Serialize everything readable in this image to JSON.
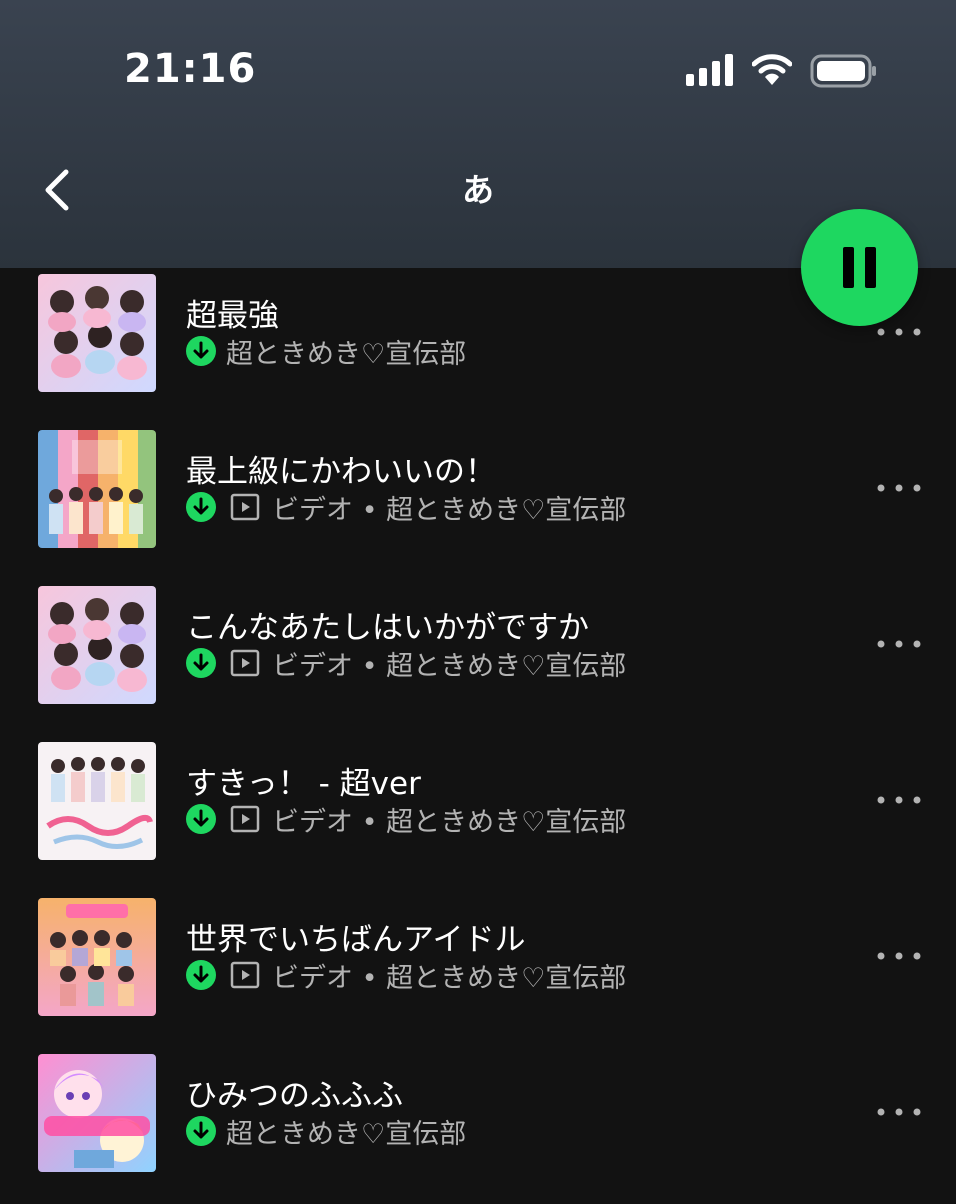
{
  "status_bar": {
    "time": "21:16",
    "signal_icon": "cellular-signal-icon",
    "wifi_icon": "wifi-icon",
    "battery_icon": "battery-icon"
  },
  "nav": {
    "title": "あ",
    "back_icon": "chevron-left-icon"
  },
  "player": {
    "state_icon": "pause-icon",
    "accent_color": "#1ed760"
  },
  "tracks": [
    {
      "title": "超最強",
      "is_video": false,
      "meta": "超ときめき♡宣伝部"
    },
    {
      "title": "最上級にかわいいの！",
      "is_video": true,
      "meta": "ビデオ • 超ときめき♡宣伝部"
    },
    {
      "title": "こんなあたしはいかがですか",
      "is_video": true,
      "meta": "ビデオ • 超ときめき♡宣伝部"
    },
    {
      "title": "すきっ！ - 超ver",
      "is_video": true,
      "meta": "ビデオ • 超ときめき♡宣伝部"
    },
    {
      "title": "世界でいちばんアイドル",
      "is_video": true,
      "meta": "ビデオ • 超ときめき♡宣伝部"
    },
    {
      "title": "ひみつのふふふ",
      "is_video": false,
      "meta": "超ときめき♡宣伝部"
    }
  ],
  "colors": {
    "background": "#121212",
    "header": "#2f3741",
    "download_green": "#1ed760",
    "secondary_text": "#b3b3b3"
  }
}
